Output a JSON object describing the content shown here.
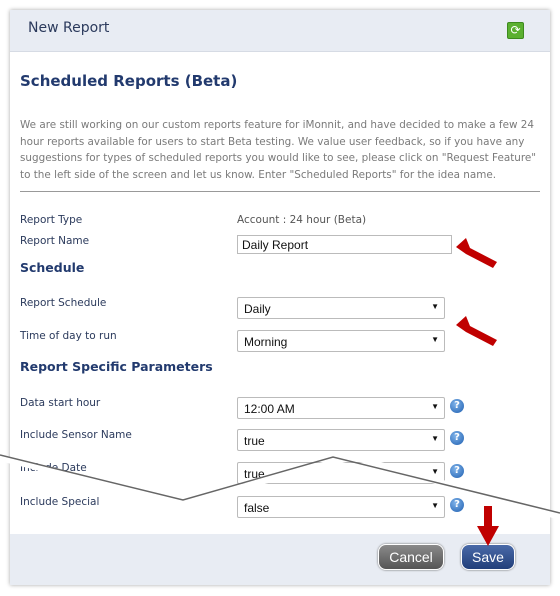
{
  "header": {
    "title": "New Report",
    "refresh_icon": "refresh-icon"
  },
  "section_title": "Scheduled Reports (Beta)",
  "intro": "We are still working on our custom reports feature for iMonnit, and have decided to make a few 24 hour reports available for users to start Beta testing. We value user feedback, so if you have any suggestions for types of scheduled reports you would like to see, please click on \"Request Feature\" to the left side of the screen and let us know. Enter \"Scheduled Reports\" for the idea name.",
  "report_type": {
    "label": "Report Type",
    "value": "Account : 24 hour (Beta)"
  },
  "report_name": {
    "label": "Report Name",
    "value": "Daily Report"
  },
  "schedule": {
    "heading": "Schedule",
    "report_schedule": {
      "label": "Report Schedule",
      "value": "Daily"
    },
    "time_of_day": {
      "label": "Time of day to run",
      "value": "Morning"
    }
  },
  "params": {
    "heading": "Report Specific Parameters",
    "items": [
      {
        "label": "Data start hour",
        "value": "12:00 AM"
      },
      {
        "label": "Include Sensor Name",
        "value": "true"
      },
      {
        "label": "Include Date",
        "value": "true"
      },
      {
        "label": "Include Special",
        "value": "false"
      }
    ]
  },
  "footer": {
    "cancel": "Cancel",
    "save": "Save"
  },
  "colors": {
    "accent": "#223a6e",
    "arrow": "#c00000"
  }
}
